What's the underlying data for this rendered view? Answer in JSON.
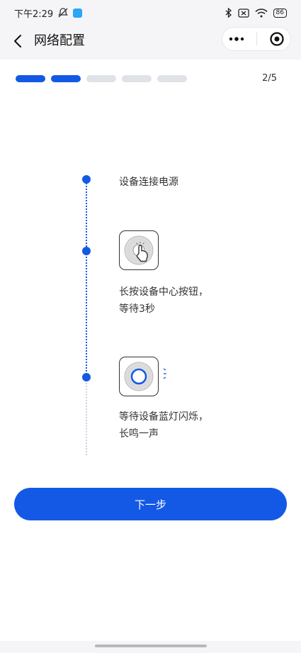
{
  "status_bar": {
    "time": "下午2:29",
    "battery": "86",
    "icons": [
      "muted-bell-icon",
      "app-icon",
      "bluetooth-icon",
      "no-sim-icon",
      "wifi-icon",
      "battery-icon"
    ]
  },
  "nav": {
    "title": "网络配置",
    "icons": [
      "back-icon",
      "more-icon",
      "target-icon"
    ]
  },
  "progress": {
    "current": 2,
    "total": 5,
    "label": "2/5",
    "colors": {
      "active": "#1459e6",
      "inactive": "#dfe3e8"
    }
  },
  "steps": [
    {
      "text": "设备连接电源"
    },
    {
      "text": "长按设备中心按钮，\n等待3秒"
    },
    {
      "text": "等待设备蓝灯闪烁，\n长鸣一声"
    }
  ],
  "button": {
    "label": "下一步",
    "color": "#1459e6"
  }
}
